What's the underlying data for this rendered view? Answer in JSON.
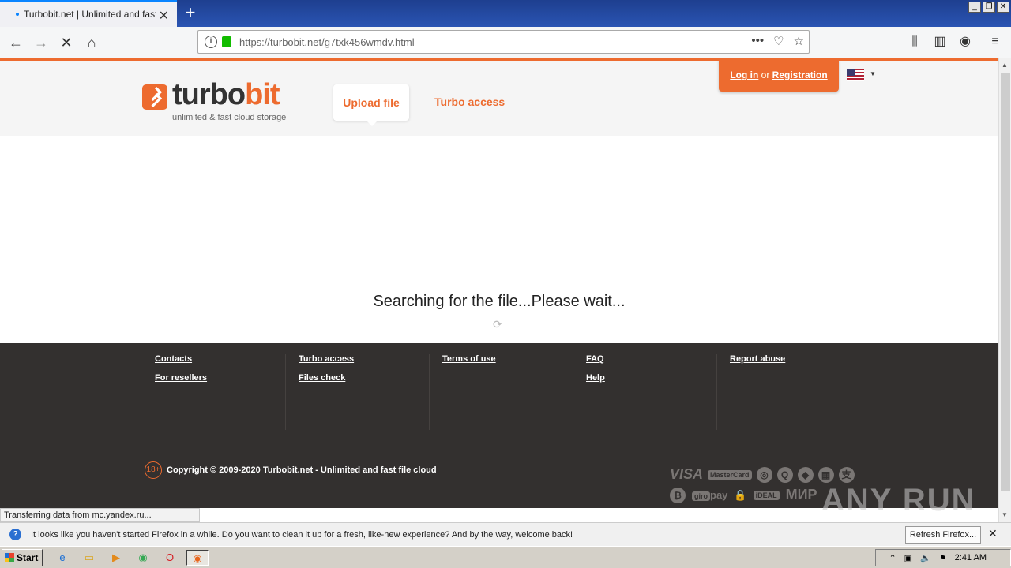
{
  "browser": {
    "tab_title": "Turbobit.net | Unlimited and fast fi",
    "url_host": "https://turbobit.net",
    "url_path": "/g7txk456wmdv.html",
    "status_text": "Transferring data from mc.yandex.ru...",
    "notification": "It looks like you haven't started Firefox in a while. Do you want to clean it up for a fresh, like-new experience? And by the way, welcome back!",
    "notification_button": "Refresh Firefox..."
  },
  "header": {
    "logo_turbo": "turbo",
    "logo_bit": "bit",
    "tagline": "unlimited & fast cloud storage",
    "upload_label": "Upload file",
    "turbo_label": "Turbo access",
    "login_label": "Log in",
    "or_label": "or",
    "register_label": "Registration"
  },
  "main": {
    "searching_text": "Searching for the file...Please wait...",
    "spinner_glyph": "⟳"
  },
  "footer": {
    "columns": [
      [
        "Contacts",
        "For resellers"
      ],
      [
        "Turbo access",
        "Files check"
      ],
      [
        "Terms of use"
      ],
      [
        "FAQ",
        "Help"
      ],
      [
        "Report abuse"
      ]
    ],
    "age_badge": "18+",
    "copyright": "Copyright © 2009-2020 Turbobit.net - Unlimited and fast file cloud",
    "payments_row1": [
      "VISA",
      "MasterCard"
    ],
    "payments_row2": [
      "giro",
      "pay",
      "iDEAL",
      "МИР"
    ]
  },
  "taskbar": {
    "start_label": "Start",
    "clock": "2:41 AM"
  },
  "watermark": "ANY RUN",
  "colors": {
    "accent": "#ed6b2f",
    "footer_bg": "#33302f"
  }
}
